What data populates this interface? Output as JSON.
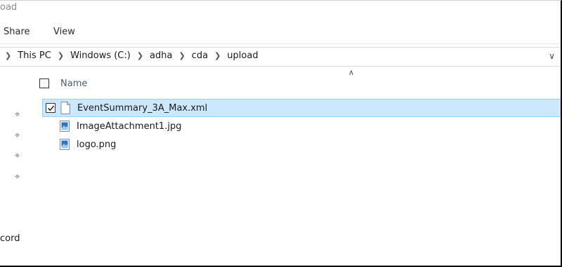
{
  "window": {
    "title_fragment": "oad"
  },
  "ribbon": {
    "tabs": [
      "Share",
      "View"
    ]
  },
  "address_bar": {
    "crumbs": [
      "This PC",
      "Windows (C:)",
      "adha",
      "cda",
      "upload"
    ],
    "dropdown_icon": "chevron-down-icon"
  },
  "list": {
    "column_name": "Name",
    "files": [
      {
        "name": "EventSummary_3A_Max.xml",
        "icon": "document-icon",
        "checked": true,
        "selected": true
      },
      {
        "name": "ImageAttachment1.jpg",
        "icon": "image-file-icon",
        "checked": false,
        "selected": false
      },
      {
        "name": "logo.png",
        "icon": "image-file-icon",
        "checked": false,
        "selected": false
      }
    ]
  },
  "sidebar": {
    "partial_label": "cord"
  },
  "colors": {
    "selection_bg": "#cce8ff",
    "selection_border": "#99d1ff",
    "header_text": "#4b5d78"
  }
}
